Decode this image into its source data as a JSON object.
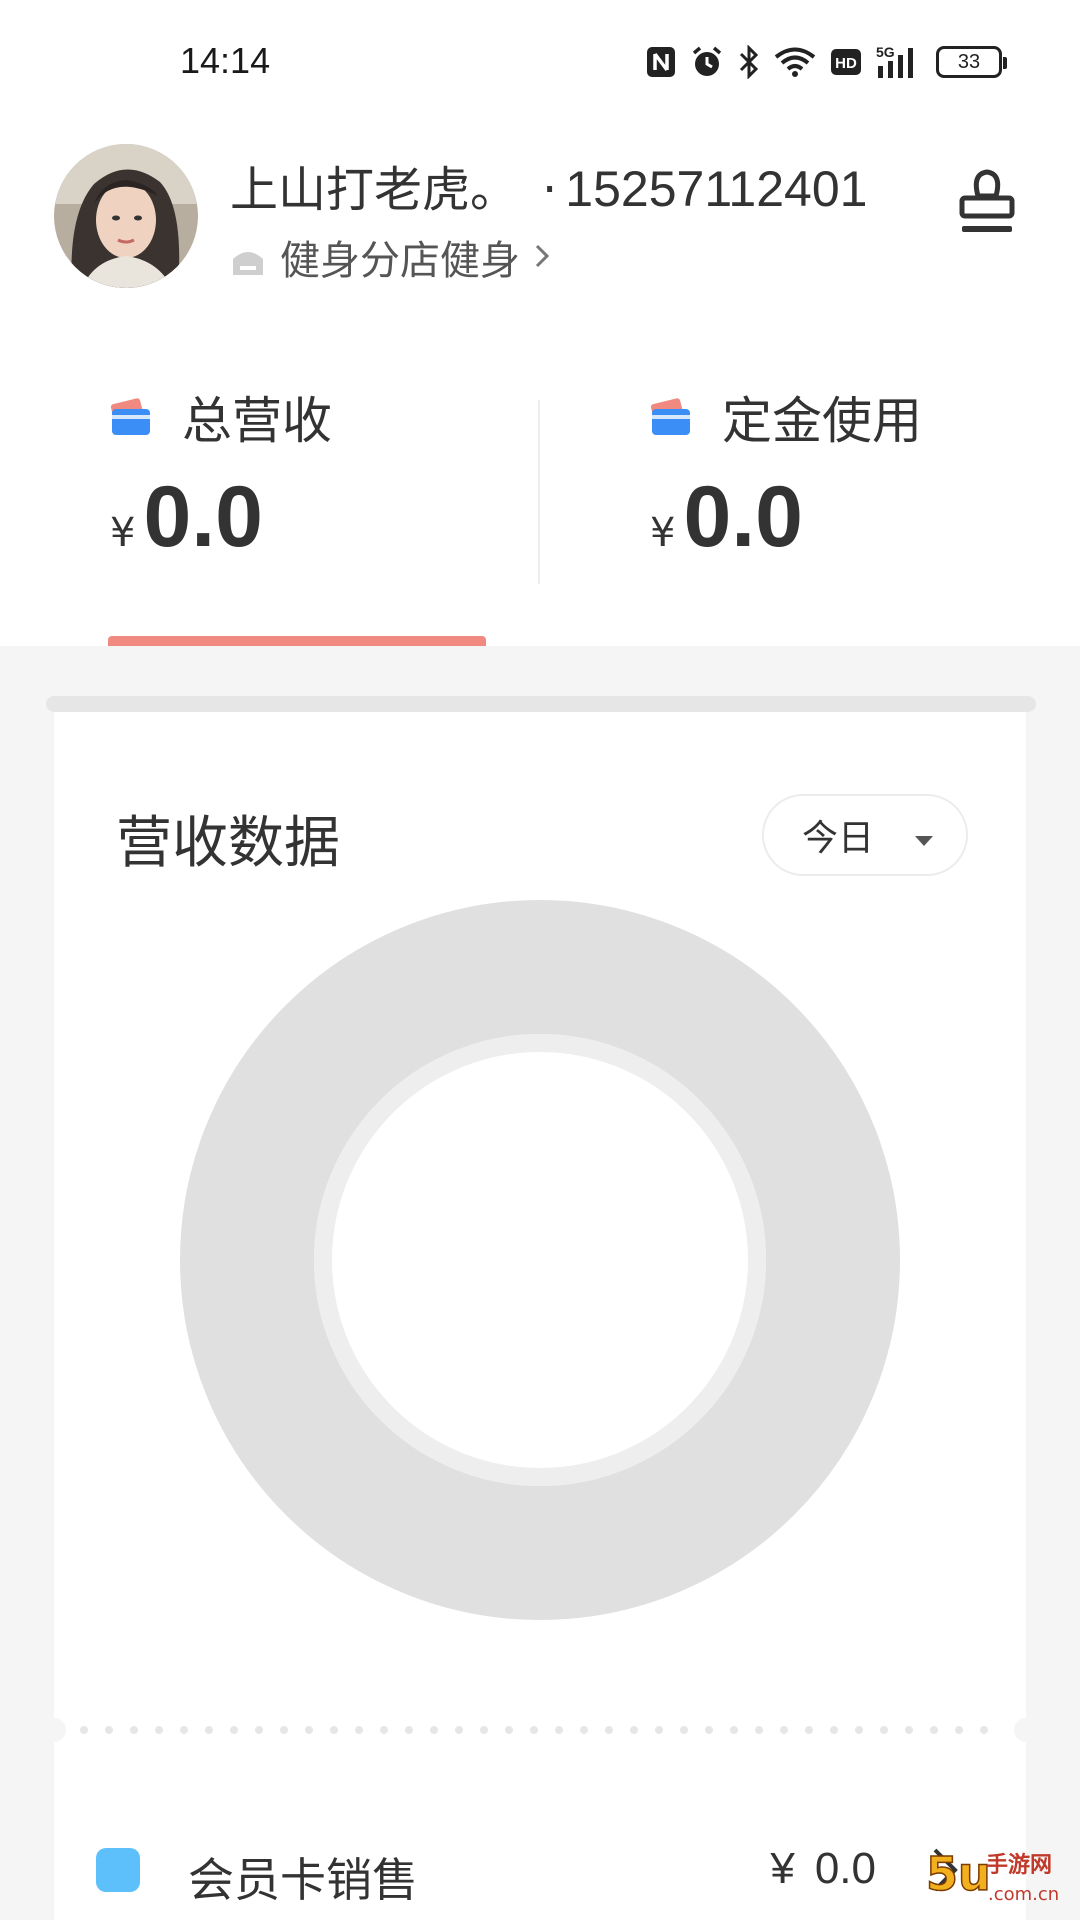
{
  "status_bar": {
    "time": "14:14",
    "battery": "33",
    "network": "5G",
    "hd_badge": "HD",
    "icons": [
      "nfc-icon",
      "alarm-icon",
      "bluetooth-icon",
      "wifi-icon",
      "hd-icon",
      "signal-5g-icon",
      "battery-icon"
    ]
  },
  "profile": {
    "name": "上山打老虎。",
    "separator": "·",
    "phone": "15257112401",
    "store_name": "健身分店健身",
    "store_chevron": "›",
    "avatar_icon": "avatar-photo",
    "action_icon": "stamp-icon"
  },
  "stats": [
    {
      "label": "总营收",
      "currency": "¥",
      "value": "0.0",
      "icon": "card-icon"
    },
    {
      "label": "定金使用",
      "currency": "¥",
      "value": "0.0",
      "icon": "card-icon"
    }
  ],
  "active_tab": 0,
  "revenue_card": {
    "title": "营收数据",
    "range": {
      "selected": "今日",
      "caret": "▼"
    }
  },
  "revenue_list": [
    {
      "label": "会员卡销售",
      "currency": "¥",
      "value": "0.0",
      "swatch_color": "#5ec0fb"
    }
  ],
  "colors": {
    "accent_underline": "#f08a80",
    "donut_ring": "#e0e0e0",
    "donut_inner": "#eeeeee",
    "page_grey": "#f5f5f5",
    "legend_blue": "#5ec0fb"
  }
}
